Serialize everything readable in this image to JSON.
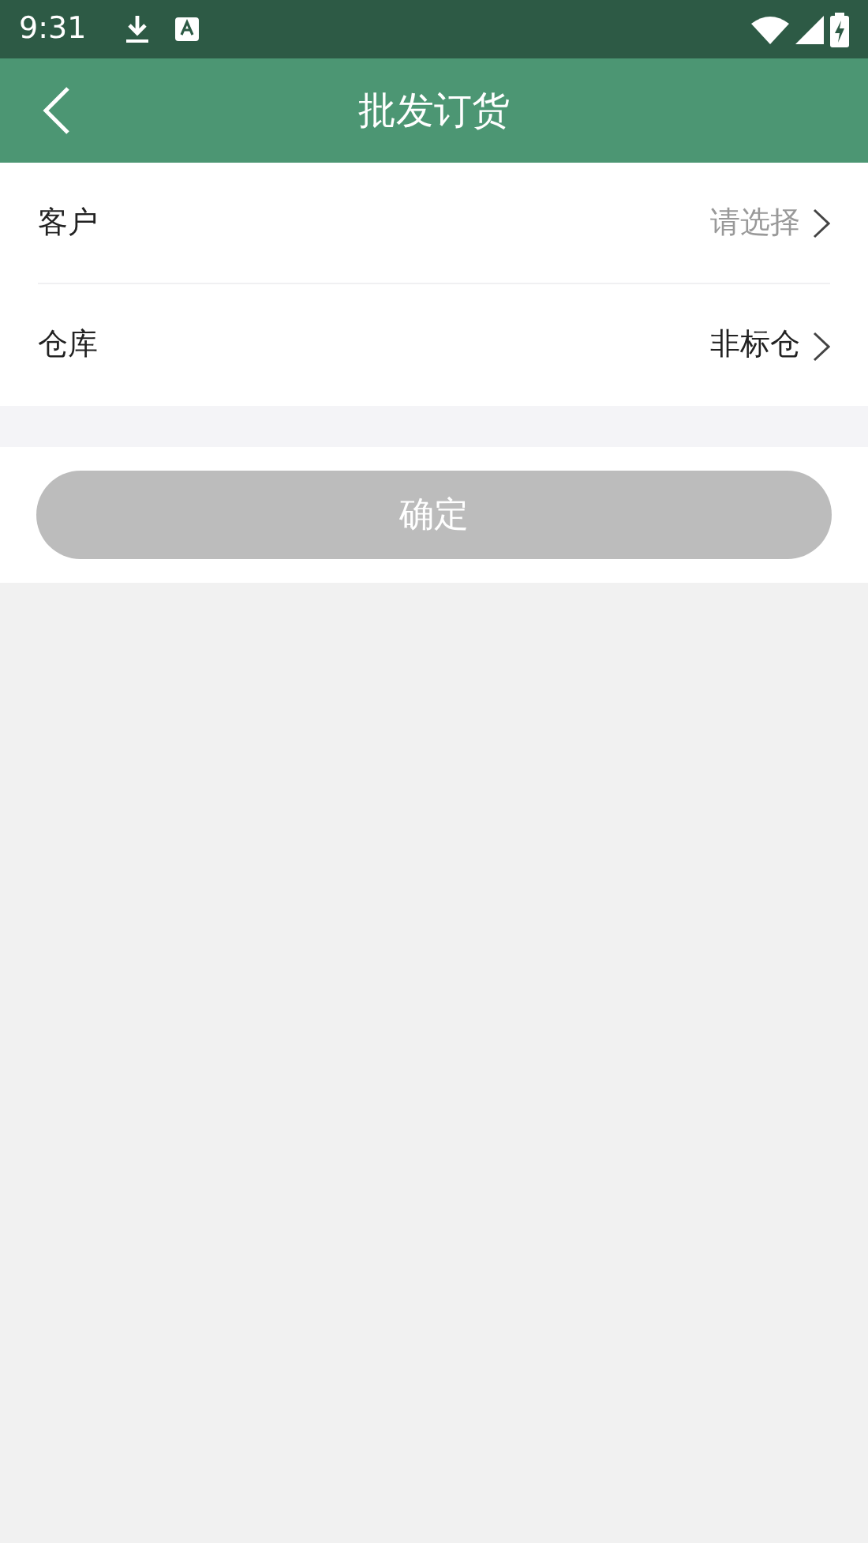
{
  "status_bar": {
    "time": "9:31"
  },
  "header": {
    "title": "批发订货"
  },
  "fields": [
    {
      "label": "客户",
      "placeholder": "请选择"
    },
    {
      "label": "仓库",
      "value": "非标仓"
    }
  ],
  "confirm_button": {
    "label": "确定",
    "disabled": true
  }
}
